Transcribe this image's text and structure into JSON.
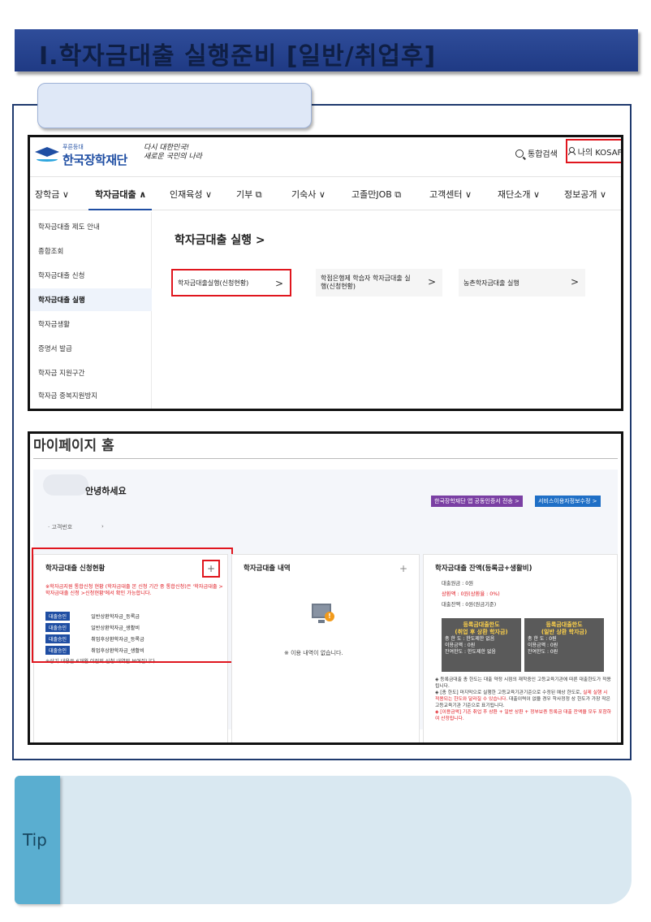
{
  "banner": {
    "title_prefix": "Ⅰ. ",
    "title": "학자금대출 실행준비 [일반/취업후]"
  },
  "header": {
    "logo_small": "푸른등대",
    "logo_main": "한국장학재단",
    "slogan_line1": "다시 대한민국!",
    "slogan_line2": "새로운 국민의 나라",
    "search_label": "통합검색",
    "mykosaf_label": "나의 KOSAF"
  },
  "gnb": {
    "items": [
      "장학금 ∨",
      "학자금대출 ∧",
      "인재육성 ∨",
      "기부 ⧉",
      "기숙사 ∨",
      "고졸만JOB ⧉",
      "고객센터 ∨",
      "재단소개 ∨",
      "정보공개 ∨"
    ]
  },
  "lnb": {
    "items": [
      "학자금대출 제도 안내",
      "종합조회",
      "학자금대출 신청",
      "학자금대출 실행",
      "학자금생활",
      "증명서 발급",
      "학자금 지원구간",
      "학자금 중복지원방지"
    ]
  },
  "content": {
    "title": "학자금대출 실행 >",
    "cards": [
      "학자금대출실행(신청현황)",
      "학점은행제 학습자 학자금대출 실행(신청현황)",
      "농촌학자금대출 실행"
    ],
    "chevron": ">"
  },
  "mypage": {
    "title": "마이페이지 홈",
    "hello": "안녕하세요",
    "btn_cert": "한국장학재단 앱 공동인증서 전송 >",
    "btn_svc": "서비스이용자정보수정 >",
    "custno_label": "고객번호",
    "custno_arrow": "›",
    "plus": "+",
    "col1": {
      "title": "학자금대출 신청현황",
      "notice": "※학자금지원 통합신청 현황 (학자금대출 본 신청 기간 중 통합신청)은 '학자금대출 >학자금대출 신청 >신청현황'에서 확인 가능합니다.",
      "rows": [
        {
          "badge": "대출승인",
          "text": "일반상환학자금_등록금"
        },
        {
          "badge": "대출승인",
          "text": "일반상환학자금_생활비"
        },
        {
          "badge": "대출승인",
          "text": "취업후상환학자금_등록금"
        },
        {
          "badge": "대출승인",
          "text": "취업후상환학자금_생활비"
        }
      ],
      "footnote": "※상기 내용은 6개월 이전의 신청 내역만 보여집니다."
    },
    "col2": {
      "title": "학자금대출 내역",
      "warn": "!",
      "empty": "※ 이용 내역이 없습니다."
    },
    "col3": {
      "title": "학자금대출 잔액(등록금+생활비)",
      "line1": "대출원금 : 0원",
      "line2": "상환액 : 0원(상환율 : 0%)",
      "line3": "대출잔액 : 0원(원금기준)",
      "box1": {
        "title": "등록금대출한도\n(취업 후 상환 학자금)",
        "l1": "총 한 도 : 한도제한 없음",
        "l2": "이용금액 : 0원",
        "l3": "잔여한도 : 한도제한 없음"
      },
      "box2": {
        "title": "등록금대출한도\n(일반 상환 학자금)",
        "l1": "총 한 도 : 0원",
        "l2": "이용금액 : 0원",
        "l3": "잔여한도 : 0원"
      },
      "d1": "◈ 등록금대출 총 한도는 대출 약정 시점의 재학중인 고등교육기관에 따른 대출한도가 적용됩니다.",
      "d2a": "◈ [총 한도] 마지막으로 실행한 고등교육기관기준으로 수정된 예상 한도로,",
      "d2b": " 실제 실행 시 적용되는 한도와 달라질 수 있습니다.",
      "d2c": " 대출이력이 없을 경우 학사정정 상 한도가 가장 작은 고등교육기관 기준으로 표기됩니다.",
      "d3a": "◈ [이용금액] 기존 취업 후 상환 + 일반 상환 + 정부보증",
      "d3b": " 등록금 대출 잔액을 모두 포함하여 산정됩니다."
    }
  },
  "tip": {
    "label": "Tip"
  },
  "colors": {
    "banner": "#1f3a84",
    "highlight": "#e0161e",
    "brand": "#1f4ea3",
    "tip_tab": "#5aaed0",
    "tip_bg": "#d9e8f1"
  }
}
